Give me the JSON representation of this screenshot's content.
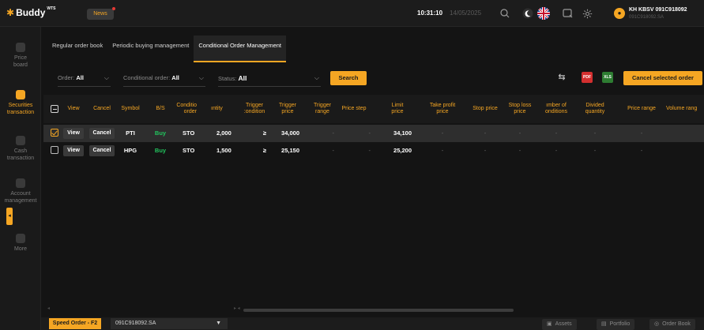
{
  "topbar": {
    "logo_text": "Buddy",
    "logo_badge": "WTS",
    "news_label": "News",
    "clock": "10:31:10",
    "date": "14/05/2025",
    "account_name": "KH KBSV 091C918092",
    "account_sub": "091C918092.SA",
    "accent": "#f5a623"
  },
  "sidebar": {
    "items": [
      {
        "label_1": "Price",
        "label_2": "board"
      },
      {
        "label_1": "Securities",
        "label_2": "transaction"
      },
      {
        "label_1": "Cash",
        "label_2": "transaction"
      },
      {
        "label_1": "Account",
        "label_2": "management"
      },
      {
        "label_1": "More",
        "label_2": ""
      }
    ]
  },
  "tabs": [
    {
      "label": "Regular order book"
    },
    {
      "label": "Periodic buying management"
    },
    {
      "label": "Conditional Order Management"
    }
  ],
  "filters": {
    "order_label": "Order:",
    "order_value": "All",
    "cond_label": "Conditional order:",
    "cond_value": "All",
    "status_label": "Status:",
    "status_value": "All",
    "search_label": "Search",
    "cancel_selected_label": "Cancel selected order",
    "pdf_label": "PDF",
    "xls_label": "XLS"
  },
  "table": {
    "headers": {
      "view": "View",
      "cancel": "Cancel",
      "symbol": "Symbol",
      "bs": "B/S",
      "cond_1": "Conditio",
      "cond_2": "order",
      "qty": "ıntity",
      "trig_cond_1": "Trigger",
      "trig_cond_2": ":ondition",
      "trig_price_1": "Trigger",
      "trig_price_2": "price",
      "trig_range_1": "Trigger",
      "trig_range_2": "range",
      "price_step": "Price step",
      "limit_1": "Limit",
      "limit_2": "price",
      "tp_1": "Take profit",
      "tp_2": "price",
      "stop_price": "Stop price",
      "sl_1": "Stop loss",
      "sl_2": "price",
      "num_cond_1": "ımber of",
      "num_cond_2": "onditions",
      "divided_1": "Divided",
      "divided_2": "quantity",
      "price_range": "Price range",
      "volume_range": "Volume rang"
    },
    "rows": [
      {
        "view": "View",
        "cancel": "Cancel",
        "symbol": "PTI",
        "bs": "Buy",
        "cond": "STO",
        "qty": "2,000",
        "trig_cond": "≥",
        "trig_price": "34,000",
        "trig_range": "-",
        "price_step": "-",
        "limit": "34,100",
        "tp": "-",
        "stop": "-",
        "sl": "-",
        "num_cond": "-",
        "divided": "-",
        "price_range": "-"
      },
      {
        "view": "View",
        "cancel": "Cancel",
        "symbol": "HPG",
        "bs": "Buy",
        "cond": "STO",
        "qty": "1,500",
        "trig_cond": "≥",
        "trig_price": "25,150",
        "trig_range": "-",
        "price_step": "-",
        "limit": "25,200",
        "tp": "-",
        "stop": "-",
        "sl": "-",
        "num_cond": "-",
        "divided": "-",
        "price_range": "-"
      }
    ]
  },
  "bottombar": {
    "speed_order": "Speed Order - F2",
    "account": "091C918092.SA",
    "assets": "Assets",
    "portfolio": "Portfolio",
    "order_book": "Order Book"
  }
}
